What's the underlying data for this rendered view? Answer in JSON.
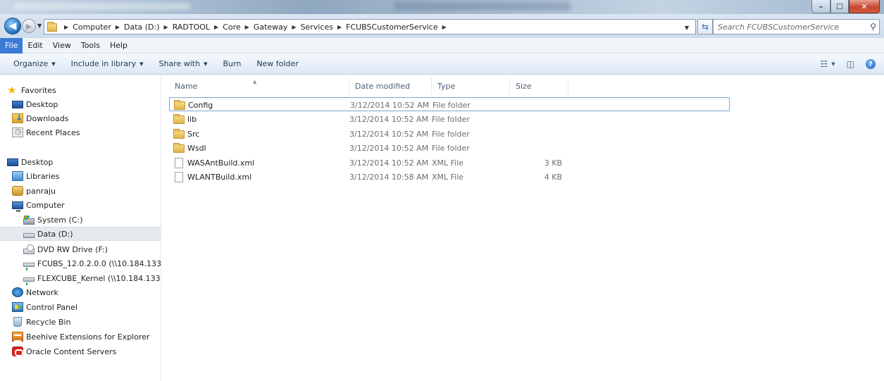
{
  "window": {
    "minimize_label": "–",
    "maximize_label": "☐",
    "close_label": "✕"
  },
  "address_bar": {
    "breadcrumbs": [
      "Computer",
      "Data (D:)",
      "RADTOOL",
      "Core",
      "Gateway",
      "Services",
      "FCUBSCustomerService"
    ],
    "search_placeholder": "Search FCUBSCustomerService"
  },
  "menu": {
    "items": [
      "File",
      "Edit",
      "View",
      "Tools",
      "Help"
    ],
    "active": "File"
  },
  "toolbar": {
    "organize": "Organize",
    "include_in_library": "Include in library",
    "share_with": "Share with",
    "burn": "Burn",
    "new_folder": "New folder"
  },
  "nav_pane": {
    "items": [
      {
        "label": "Favorites",
        "icon": "star-icon"
      },
      {
        "label": "Desktop",
        "icon": "desktop-icon"
      },
      {
        "label": "Downloads",
        "icon": "downloads-icon"
      },
      {
        "label": "Recent Places",
        "icon": "recent-places-icon"
      },
      {
        "label": "Desktop",
        "icon": "desktop-icon"
      },
      {
        "label": "Libraries",
        "icon": "libraries-icon"
      },
      {
        "label": "panraju",
        "icon": "user-folder-icon"
      },
      {
        "label": "Computer",
        "icon": "computer-icon"
      },
      {
        "label": "System (C:)",
        "icon": "system-drive-icon"
      },
      {
        "label": "Data (D:)",
        "icon": "drive-icon"
      },
      {
        "label": "DVD RW Drive (F:)",
        "icon": "dvd-drive-icon"
      },
      {
        "label": "FCUBS_12.0.2.0.0 (\\\\10.184.133.",
        "icon": "network-drive-icon"
      },
      {
        "label": "FLEXCUBE_Kernel (\\\\10.184.133.",
        "icon": "network-drive-icon"
      },
      {
        "label": "Network",
        "icon": "network-icon"
      },
      {
        "label": "Control Panel",
        "icon": "control-panel-icon"
      },
      {
        "label": "Recycle Bin",
        "icon": "recycle-bin-icon"
      },
      {
        "label": "Beehive Extensions for Explorer",
        "icon": "beehive-icon"
      },
      {
        "label": "Oracle Content Servers",
        "icon": "oracle-icon"
      }
    ],
    "selected": "Data (D:)"
  },
  "file_list": {
    "columns": [
      "Name",
      "Date modified",
      "Type",
      "Size"
    ],
    "rows": [
      {
        "name": "Config",
        "date": "3/12/2014 10:52 AM",
        "type": "File folder",
        "size": "",
        "icon": "folder-icon"
      },
      {
        "name": "lib",
        "date": "3/12/2014 10:52 AM",
        "type": "File folder",
        "size": "",
        "icon": "folder-icon"
      },
      {
        "name": "Src",
        "date": "3/12/2014 10:52 AM",
        "type": "File folder",
        "size": "",
        "icon": "folder-icon"
      },
      {
        "name": "Wsdl",
        "date": "3/12/2014 10:52 AM",
        "type": "File folder",
        "size": "",
        "icon": "folder-icon"
      },
      {
        "name": "WASAntBuild.xml",
        "date": "3/12/2014 10:52 AM",
        "type": "XML File",
        "size": "3 KB",
        "icon": "xml-file-icon"
      },
      {
        "name": "WLANTBuild.xml",
        "date": "3/12/2014 10:58 AM",
        "type": "XML File",
        "size": "4 KB",
        "icon": "xml-file-icon"
      }
    ]
  },
  "colors": {
    "menu_active": "#3a7bd5",
    "selected_nav": "#e6e9ee",
    "focus_border": "#7da2ce"
  }
}
